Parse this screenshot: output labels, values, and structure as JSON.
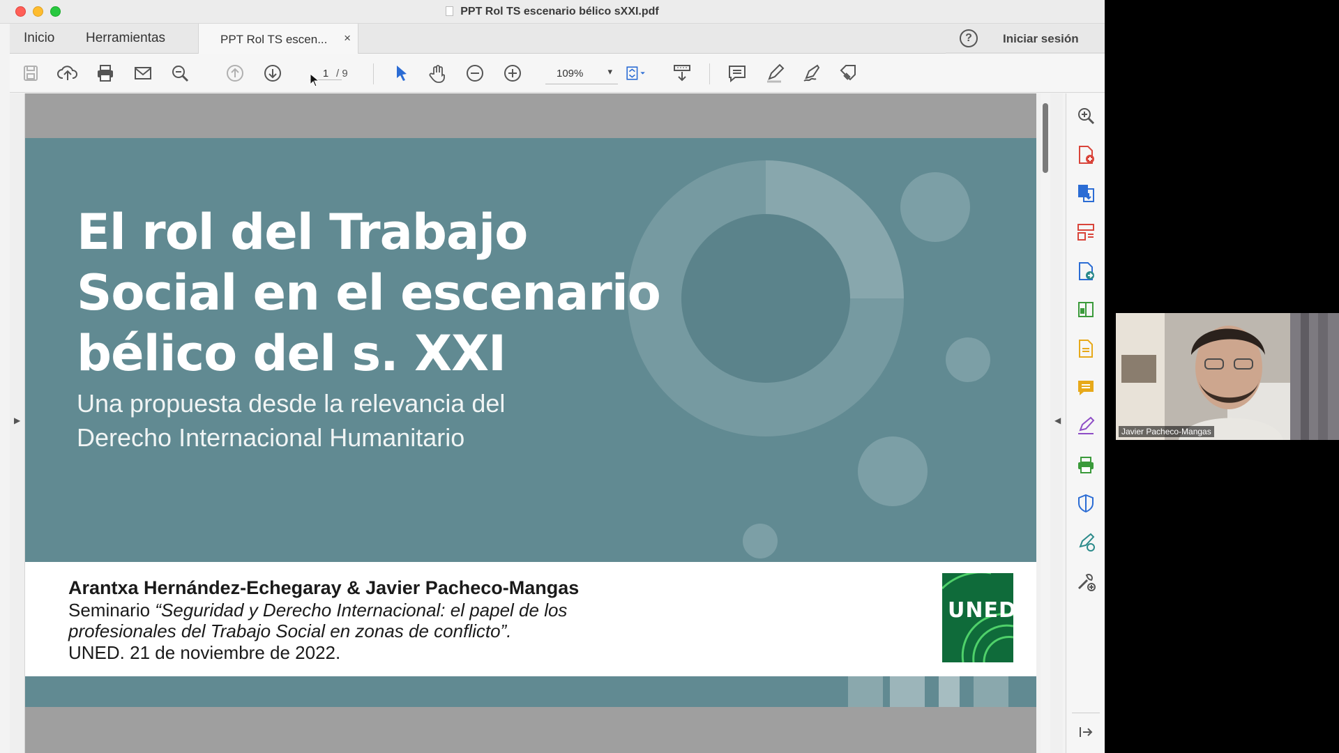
{
  "window": {
    "title": "PPT Rol TS escenario bélico sXXI.pdf"
  },
  "tabs": {
    "home": "Inicio",
    "tools": "Herramientas",
    "document": "PPT Rol TS escen...",
    "close": "×"
  },
  "account": {
    "help": "?",
    "signin": "Iniciar sesión"
  },
  "toolbar": {
    "page_current": "1",
    "page_total": "/ 9",
    "zoom": "109%",
    "zoom_caret": "▾"
  },
  "slide": {
    "title_line1": "El rol del Trabajo",
    "title_line2": "Social en el escenario",
    "title_line3": "bélico del s. XXI",
    "subtitle_line1": "Una propuesta desde la relevancia del",
    "subtitle_line2": "Derecho Internacional Humanitario",
    "authors": "Arantxa Hernández-Echegaray & Javier Pacheco-Mangas",
    "seminar_prefix": "Seminario ",
    "seminar_italic_1": "“Seguridad y Derecho Internacional: el papel de los",
    "seminar_italic_2": "profesionales del Trabajo Social en zonas de conflicto”.",
    "date_line": "UNED. 21 de noviembre de 2022.",
    "logo_text": "UNED"
  },
  "webcam": {
    "participant": "Javier Pacheco-Mangas"
  },
  "colors": {
    "slide_bg": "#618a92",
    "accent_blue": "#2b6cd4",
    "tool_red": "#d9443a",
    "tool_yellow": "#e7a91a",
    "uned_green": "#0f6b3a"
  }
}
